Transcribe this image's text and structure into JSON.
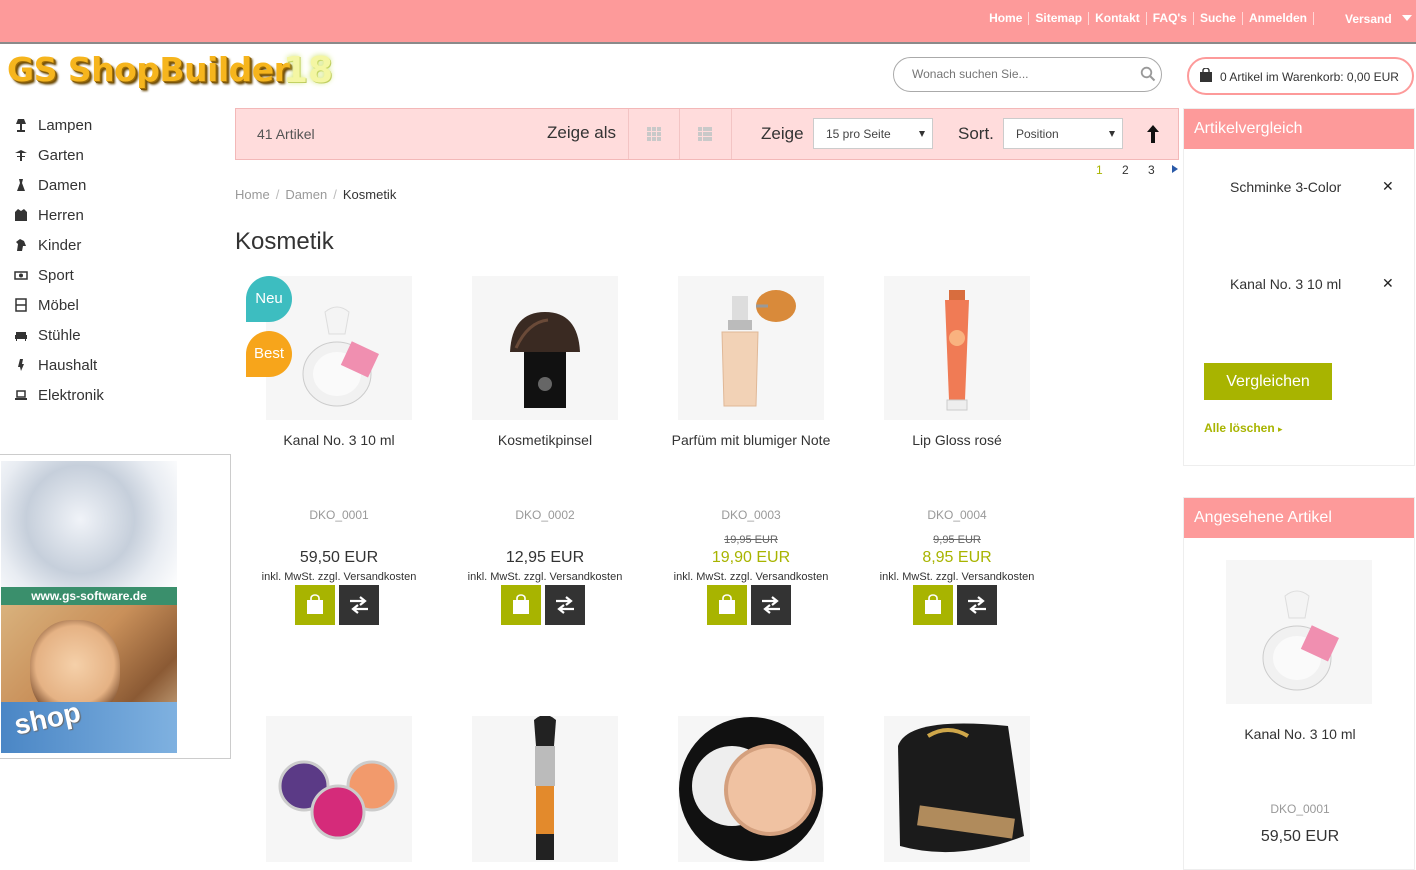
{
  "topnav": {
    "links": [
      "Home",
      "Sitemap",
      "Kontakt",
      "FAQ's",
      "Suche",
      "Anmelden"
    ],
    "versand": "Versand"
  },
  "logo": {
    "text": "GS ShopBuilder",
    "version": "18"
  },
  "search": {
    "placeholder": "Wonach suchen Sie..."
  },
  "cart": {
    "label": "0 Artikel im Warenkorb: 0,00 EUR"
  },
  "categories": [
    {
      "label": "Lampen",
      "icon": "lamp-icon"
    },
    {
      "label": "Garten",
      "icon": "garden-icon"
    },
    {
      "label": "Damen",
      "icon": "dress-icon"
    },
    {
      "label": "Herren",
      "icon": "jacket-icon"
    },
    {
      "label": "Kinder",
      "icon": "horse-icon"
    },
    {
      "label": "Sport",
      "icon": "sport-icon"
    },
    {
      "label": "Möbel",
      "icon": "cabinet-icon"
    },
    {
      "label": "Stühle",
      "icon": "sofa-icon"
    },
    {
      "label": "Haushalt",
      "icon": "mixer-icon"
    },
    {
      "label": "Elektronik",
      "icon": "laptop-icon"
    }
  ],
  "banner": {
    "url": "www.gs-software.de",
    "shop": "shop"
  },
  "toolbar": {
    "count": "41 Artikel",
    "view_label": "Zeige als",
    "per_page_label": "Zeige",
    "per_page_value": "15 pro Seite",
    "sort_label": "Sort.",
    "sort_value": "Position"
  },
  "pager": {
    "pages": [
      "1",
      "2",
      "3"
    ],
    "current": "1"
  },
  "breadcrumb": [
    "Home",
    "Damen",
    "Kosmetik"
  ],
  "page_title": "Kosmetik",
  "products": [
    {
      "name": "Kanal No. 3 10 ml",
      "sku": "DKO_0001",
      "old_price": "",
      "price": "59,50 EUR",
      "tax": "inkl. MwSt. zzgl. Versandkosten",
      "badges": [
        "Neu",
        "Best"
      ]
    },
    {
      "name": "Kosmetikpinsel",
      "sku": "DKO_0002",
      "old_price": "",
      "price": "12,95 EUR",
      "tax": "inkl. MwSt. zzgl. Versandkosten",
      "badges": []
    },
    {
      "name": "Parfüm mit blumiger Note",
      "sku": "DKO_0003",
      "old_price": "19,95 EUR",
      "price": "19,90 EUR",
      "tax": "inkl. MwSt. zzgl. Versandkosten",
      "badges": []
    },
    {
      "name": "Lip Gloss rosé",
      "sku": "DKO_0004",
      "old_price": "9,95 EUR",
      "price": "8,95 EUR",
      "tax": "inkl. MwSt. zzgl. Versandkosten",
      "badges": []
    }
  ],
  "compare": {
    "title": "Artikelvergleich",
    "items": [
      "Schminke 3-Color",
      "Kanal No. 3 10 ml"
    ],
    "button": "Vergleichen",
    "clear": "Alle löschen"
  },
  "viewed": {
    "title": "Angesehene Artikel",
    "name": "Kanal No. 3 10 ml",
    "sku": "DKO_0001",
    "price": "59,50 EUR"
  },
  "colors": {
    "brand_pink": "#fd9a9a",
    "accent_green": "#a8b400",
    "badge_teal": "#3dbdc0",
    "badge_orange": "#f7a51b"
  }
}
